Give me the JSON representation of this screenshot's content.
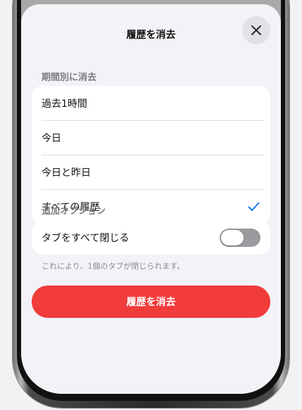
{
  "sheet": {
    "title": "履歴を消去",
    "close_icon": "close-icon"
  },
  "time_range": {
    "section_label": "期間別に消去",
    "options": [
      {
        "label": "過去1時間",
        "selected": false
      },
      {
        "label": "今日",
        "selected": false
      },
      {
        "label": "今日と昨日",
        "selected": false
      },
      {
        "label": "すべての履歴",
        "selected": true
      }
    ],
    "check_icon": "checkmark-icon",
    "accent_color": "#1a7cf0"
  },
  "additional_options": {
    "section_label": "追加オプション",
    "close_tabs_label": "タブをすべて閉じる",
    "close_tabs_enabled": false,
    "footnote": "これにより、1個のタブが閉じられます。"
  },
  "actions": {
    "clear_button_label": "履歴を消去",
    "clear_button_color": "#f23b3b"
  }
}
